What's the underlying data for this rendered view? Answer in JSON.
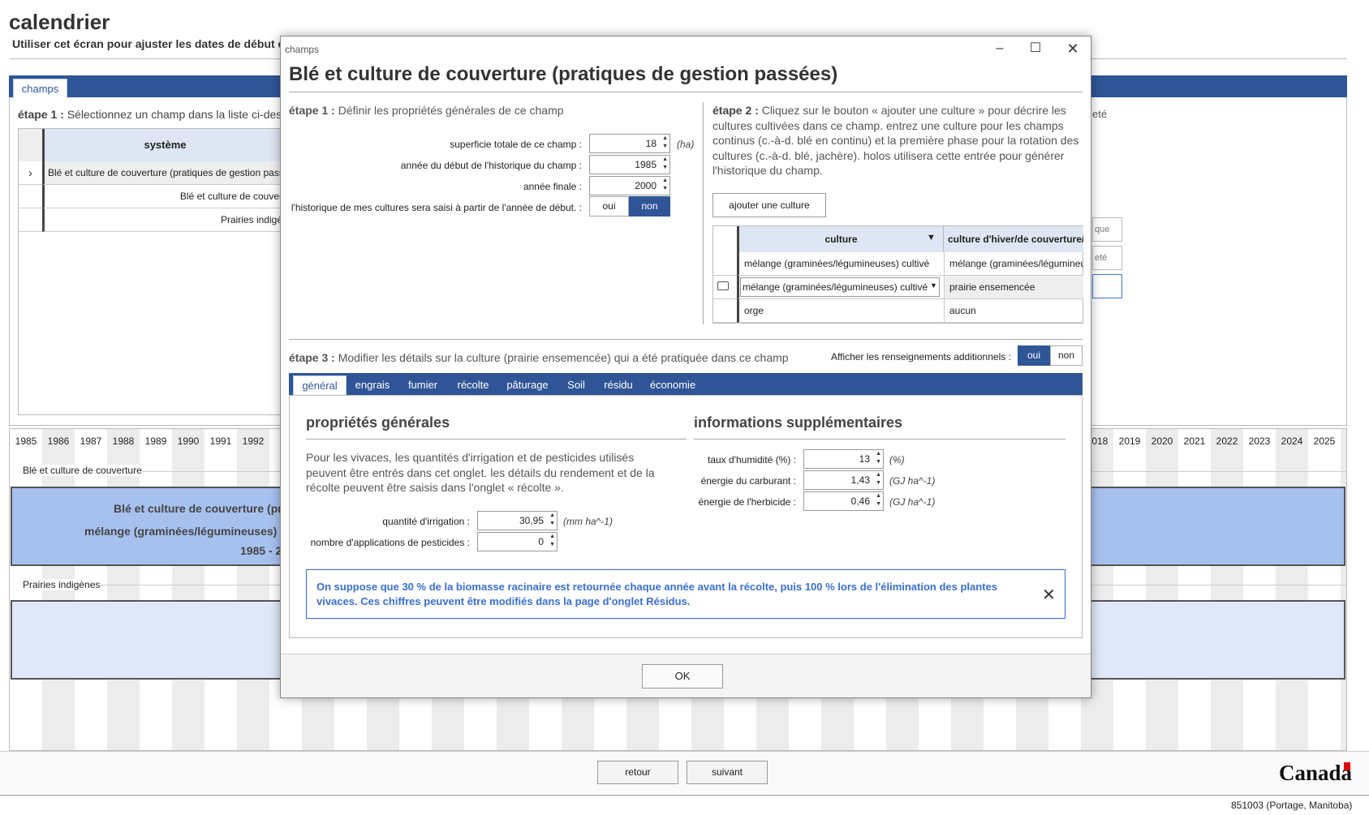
{
  "app": {
    "title": "calendrier",
    "subtitle": "Utiliser cet écran pour ajuster les dates de début et",
    "tab": "champs",
    "step1": "étape 1 :",
    "step1_text": " Sélectionnez un champ dans la liste ci-dess",
    "grid_header": "système",
    "grid_rows": [
      "Blé et culture de couverture (pratiques de gestion pass",
      "Blé et culture de couver",
      "Prairies indigè"
    ],
    "right_text": "eté",
    "right_boxes": [
      "que",
      "eté",
      ""
    ]
  },
  "timeline": {
    "years": [
      "1985",
      "1986",
      "1987",
      "1988",
      "1989",
      "1990",
      "1991",
      "1992",
      "1",
      "",
      "",
      "",
      "",
      "",
      "",
      "",
      "",
      "",
      "",
      "",
      "",
      "",
      "",
      "",
      "",
      "",
      "",
      "",
      "",
      "",
      "",
      "",
      "",
      "2018",
      "2019",
      "2020",
      "2021",
      "2022",
      "2023",
      "2024",
      "2025"
    ],
    "group1_label": "Blé et culture de couverture",
    "bar1_line1": "Blé et culture de couverture (pr",
    "bar1_line2": "mélange (graminées/légumineuses) c",
    "bar1_line3": "1985 - 2",
    "group2_label": "Prairies indigènes"
  },
  "bottom": {
    "back": "retour",
    "next": "suivant",
    "canada": "Canada",
    "status": "851003 (Portage, Manitoba)"
  },
  "dialog": {
    "caption": "champs",
    "title": "Blé et culture de couverture (pratiques de gestion passées)",
    "step1_bold": "étape 1 :",
    "step1_text": " Définir les propriétés générales de ce champ",
    "fields": {
      "area_label": "superficie totale de ce champ :",
      "area_value": "18",
      "area_unit": "(ha)",
      "start_label": "année du début de l'historique du champ :",
      "start_value": "1985",
      "end_label": "année finale :",
      "end_value": "2000",
      "history_label": "l'historique de mes cultures sera saisi à partir de l'année de début. :",
      "yes": "oui",
      "no": "non"
    },
    "step2_bold": "étape 2 :",
    "step2_text": " Cliquez sur le bouton « ajouter une culture » pour décrire les cultures cultivées dans ce champ. entrez une culture pour les champs continus (c.-à-d. blé en continu) et la première phase pour la rotation des cultures (c.-à-d. blé, jachère). holos utilisera cette entrée pour générer l'historique du champ.",
    "add_crop": "ajouter une culture",
    "crop_grid": {
      "col1": "culture",
      "col2": "culture d'hiver/de couverture/",
      "rows": [
        {
          "crop": "mélange (graminées/légumineuses) cultivé",
          "cover": "mélange (graminées/légumineu"
        },
        {
          "crop": "mélange (graminées/légumineuses) cultivé",
          "cover": "prairie ensemencée"
        },
        {
          "crop": "orge",
          "cover": "aucun"
        }
      ]
    },
    "step3_bold": "étape 3 :",
    "step3_text": " Modifier les détails sur la culture (prairie ensemencée) qui a été pratiquée dans ce champ",
    "addl_label": "Afficher les renseignements additionnels :",
    "addl_yes": "oui",
    "addl_no": "non",
    "tabs": [
      "général",
      "engrais",
      "fumier",
      "récolte",
      "pâturage",
      "Soil",
      "résidu",
      "économie"
    ],
    "general_title": "propriétés générales",
    "general_desc": "Pour les vivaces, les quantités d'irrigation et de pesticides utilisés peuvent être entrés dans cet onglet. les détails du rendement et de la récolte peuvent être saisis dans l'onglet « récolte ».",
    "irrigation_label": "quantité d'irrigation :",
    "irrigation_value": "30,95",
    "irrigation_unit": "(mm ha^-1)",
    "pesticide_label": "nombre d'applications de pesticides :",
    "pesticide_value": "0",
    "info_title": "informations supplémentaires",
    "moisture_label": "taux d'humidité (%) :",
    "moisture_value": "13",
    "moisture_unit": "(%)",
    "fuel_label": "énergie du carburant :",
    "fuel_value": "1,43",
    "fuel_unit": "(GJ ha^-1)",
    "herbicide_label": "énergie de l'herbicide :",
    "herbicide_value": "0,46",
    "herbicide_unit": "(GJ ha^-1)",
    "note": "On suppose que 30 % de la biomasse racinaire est retournée chaque année avant la récolte, puis 100 % lors de l'élimination des plantes vivaces. Ces chiffres peuvent être modifiés dans la page d'onglet Résidus.",
    "ok": "OK"
  },
  "colors": {
    "accent": "#2f5597",
    "note": "#3a6fd0"
  }
}
